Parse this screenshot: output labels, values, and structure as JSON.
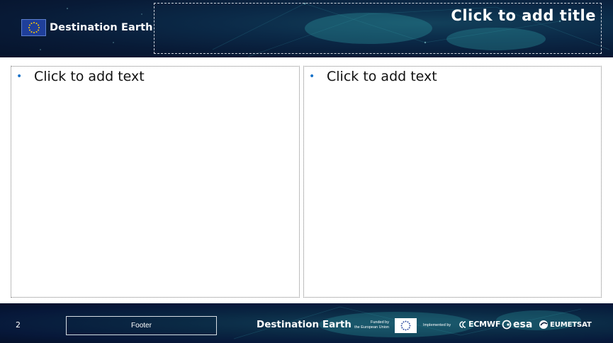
{
  "header": {
    "brand_name": "Destination Earth",
    "brand_logo_icon": "eu-flag-icon",
    "title_placeholder": "Click to add title"
  },
  "content": {
    "left": {
      "bullet_text": "Click to add text"
    },
    "right": {
      "bullet_text": "Click to add text"
    }
  },
  "footer": {
    "page_number": "2",
    "footer_text": "Footer",
    "brand_name": "Destination Earth",
    "funded_by_line1": "Funded by",
    "funded_by_line2": "the European Union",
    "implemented_by": "Implemented by",
    "partners": [
      "ECMWF",
      "esa",
      "EUMETSAT"
    ]
  },
  "colors": {
    "header_background": "#081a36",
    "bullet": "#1a73c9",
    "eu_flag_blue": "#1f3f9a",
    "eu_star_yellow": "#ffcc00"
  }
}
